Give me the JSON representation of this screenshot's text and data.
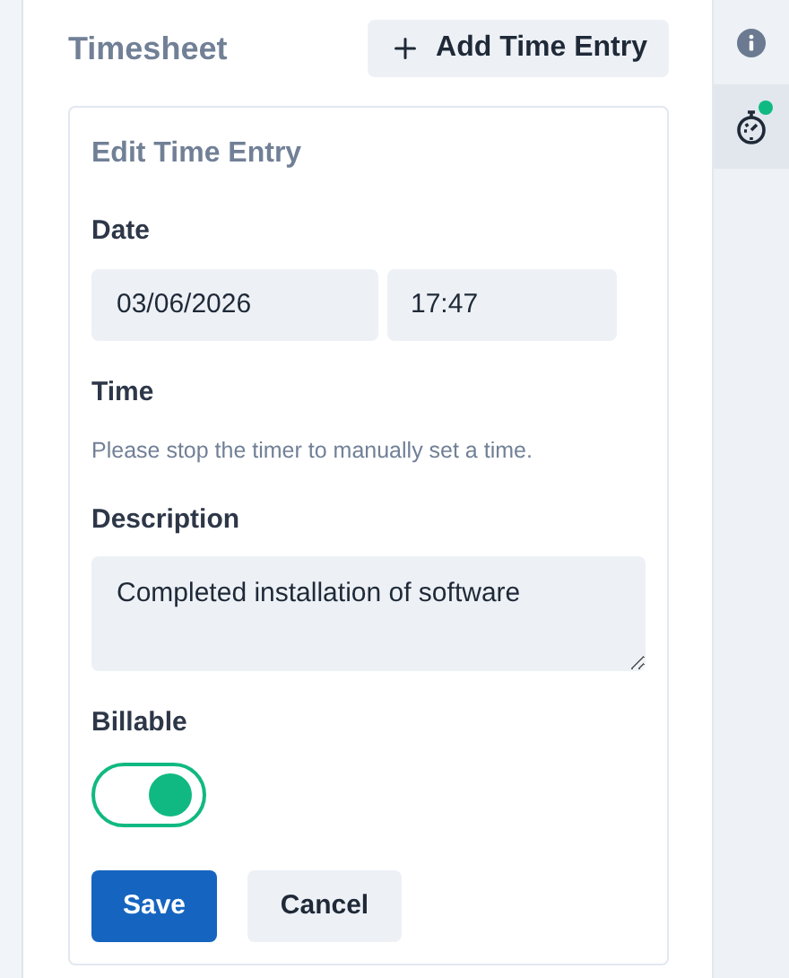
{
  "panel": {
    "title": "Timesheet",
    "add_button": "Add Time Entry"
  },
  "form": {
    "title": "Edit Time Entry",
    "date_label": "Date",
    "date_value": "03/06/2026",
    "time_value": "17:47",
    "time_label": "Time",
    "time_hint": "Please stop the timer to manually set a time.",
    "description_label": "Description",
    "description_value": "Completed installation of software",
    "billable_label": "Billable",
    "billable_on": true,
    "save": "Save",
    "cancel": "Cancel"
  },
  "rail": [
    {
      "kind": "info",
      "selected": false,
      "running": false
    },
    {
      "kind": "timer",
      "selected": true,
      "running": true
    }
  ]
}
